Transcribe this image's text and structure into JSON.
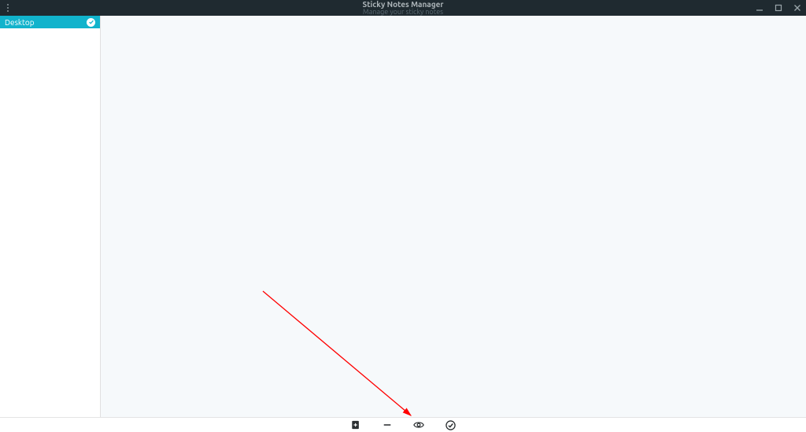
{
  "titlebar": {
    "title": "Sticky Notes Manager",
    "subtitle": "Manage your sticky notes"
  },
  "sidebar": {
    "items": [
      {
        "label": "Desktop",
        "checked": true
      }
    ]
  },
  "colors": {
    "accent": "#11b3cc",
    "titlebar_bg": "#1f2a30",
    "content_bg": "#f6f9fb"
  }
}
